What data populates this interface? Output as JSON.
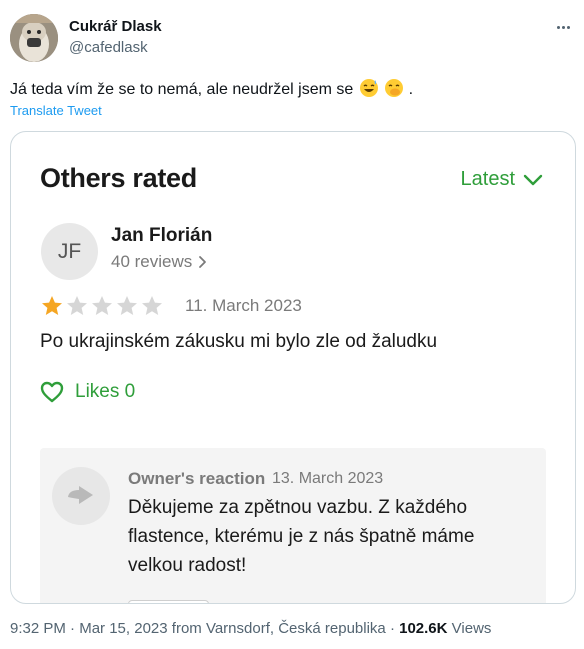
{
  "tweet": {
    "author_name": "Cukrář Dlask",
    "author_handle": "@cafedlask",
    "text": "Já teda vím že se to nemá, ale neudržel jsem se",
    "emojis": [
      "grinning-sweat-emoji",
      "hand-over-mouth-emoji"
    ],
    "text_suffix": ".",
    "translate_label": "Translate Tweet"
  },
  "review_card": {
    "section_title": "Others rated",
    "sort_label": "Latest",
    "reviewer": {
      "initials": "JF",
      "name": "Jan Florián",
      "review_count": "40 reviews"
    },
    "rating": {
      "value": 1,
      "max": 5
    },
    "date": "11. March 2023",
    "body": "Po ukrajinském zákusku mi bylo zle od žaludku",
    "likes_label": "Likes 0",
    "owner_reaction": {
      "label": "Owner's reaction",
      "date": "13. March 2023",
      "text": "Děkujeme za zpětnou vazbu. Z každého flastence, kterému je z nás špatně máme velkou radost!"
    }
  },
  "meta": {
    "time": "9:32 PM",
    "date": "Mar 15, 2023",
    "source": "from Varnsdorf, Česká republika",
    "separator": "·",
    "views_count": "102.6K",
    "views_label": "Views"
  },
  "colors": {
    "accent_green": "#2f9e3a",
    "star_filled": "#f5a623",
    "star_empty": "#d6d6d6",
    "link_blue": "#1d9bf0"
  }
}
